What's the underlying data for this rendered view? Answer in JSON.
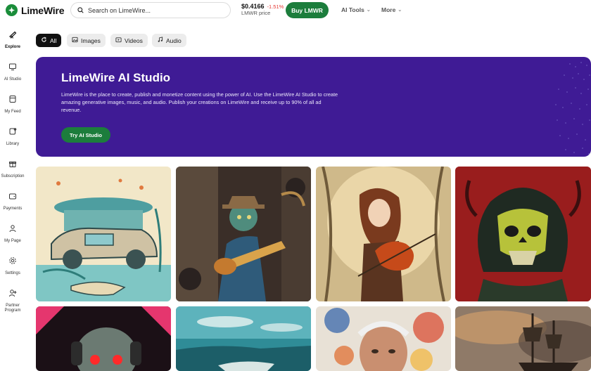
{
  "brand": {
    "name": "LimeWire"
  },
  "search": {
    "placeholder": "Search on LimeWire..."
  },
  "token": {
    "price": "$0.4166",
    "change": "-1.51%",
    "label": "LMWR price"
  },
  "header": {
    "buy_label": "Buy LMWR",
    "ai_tools_label": "AI Tools",
    "more_label": "More"
  },
  "sidebar": {
    "items": [
      {
        "label": "Explore",
        "icon": "telescope-icon"
      },
      {
        "label": "AI Studio",
        "icon": "monitor-icon"
      },
      {
        "label": "My Feed",
        "icon": "feed-icon"
      },
      {
        "label": "Library",
        "icon": "library-icon"
      },
      {
        "label": "Subscription",
        "icon": "gift-icon"
      },
      {
        "label": "Payments",
        "icon": "wallet-icon"
      },
      {
        "label": "My Page",
        "icon": "user-icon"
      },
      {
        "label": "Settings",
        "icon": "gear-icon"
      },
      {
        "label": "Partner Program",
        "icon": "partner-icon"
      }
    ]
  },
  "filters": [
    {
      "label": "All",
      "active": true
    },
    {
      "label": "Images",
      "active": false
    },
    {
      "label": "Videos",
      "active": false
    },
    {
      "label": "Audio",
      "active": false
    }
  ],
  "hero": {
    "title": "LimeWire AI Studio",
    "description": "LimeWire is the place to create, publish and monetize content using the power of AI. Use the LimeWire AI Studio to create amazing generative images, music, and audio. Publish your creations on LimeWire and receive up to 90% of all ad revenue.",
    "cta_label": "Try AI Studio"
  },
  "gallery": {
    "items": [
      {
        "subject": "underwater-car-artwork"
      },
      {
        "subject": "zombie-guitarist-artwork"
      },
      {
        "subject": "violinist-girl-artwork"
      },
      {
        "subject": "skull-warrior-artwork"
      },
      {
        "subject": "robot-headphones-artwork"
      },
      {
        "subject": "ocean-boat-artwork"
      },
      {
        "subject": "paint-portrait-artwork"
      },
      {
        "subject": "pirate-ship-artwork"
      }
    ]
  },
  "colors": {
    "brand_green": "#1c7d3c",
    "hero_purple": "#3f1b95",
    "negative": "#e53935"
  }
}
